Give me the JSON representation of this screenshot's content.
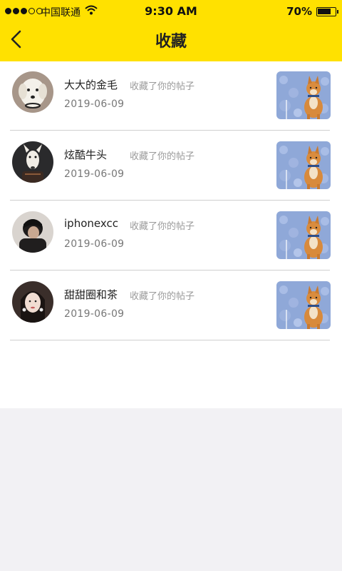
{
  "status_bar": {
    "carrier": "中国联通",
    "time": "9:30 AM",
    "battery": "70%"
  },
  "header": {
    "title": "收藏",
    "back_icon": "chevron-left-icon",
    "background": "#ffe100"
  },
  "favorites": [
    {
      "name": "大大的金毛",
      "action": "收藏了你的帖子",
      "date": "2019-06-09",
      "avatar": "white-dog"
    },
    {
      "name": "炫酷牛头",
      "action": "收藏了你的帖子",
      "date": "2019-06-09",
      "avatar": "bull-terrier"
    },
    {
      "name": "iphonexcc",
      "action": "收藏了你的帖子",
      "date": "2019-06-09",
      "avatar": "person-dark"
    },
    {
      "name": "甜甜圈和茶",
      "action": "收藏了你的帖子",
      "date": "2019-06-09",
      "avatar": "woman-portrait"
    }
  ],
  "post_thumbnail": "shiba-dog-flowers"
}
